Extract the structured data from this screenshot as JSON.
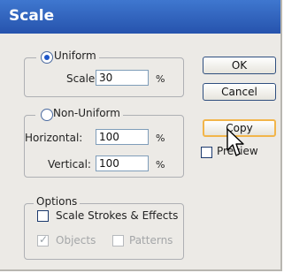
{
  "window": {
    "title": "Scale"
  },
  "uniform": {
    "legend": "Uniform",
    "selected": true,
    "scale_label": "Scale:",
    "scale_value": "30",
    "scale_unit": "%"
  },
  "non_uniform": {
    "legend": "Non-Uniform",
    "selected": false,
    "horizontal_label": "Horizontal:",
    "horizontal_value": "100",
    "horizontal_unit": "%",
    "vertical_label": "Vertical:",
    "vertical_value": "100",
    "vertical_unit": "%"
  },
  "options": {
    "legend": "Options",
    "scale_strokes_label": "Scale Strokes & Effects",
    "scale_strokes_checked": false,
    "objects_label": "Objects",
    "objects_checked": true,
    "objects_enabled": false,
    "patterns_label": "Patterns",
    "patterns_checked": false,
    "patterns_enabled": false
  },
  "buttons": {
    "ok": "OK",
    "cancel": "Cancel",
    "copy": "Copy"
  },
  "preview": {
    "label": "Preview",
    "checked": false
  },
  "colors": {
    "titlebar": "#2f63c2",
    "dialog_bg": "#eceae6",
    "focus_border": "#f2b54a"
  },
  "icons": {
    "pointer": "arrow-cursor-icon"
  }
}
